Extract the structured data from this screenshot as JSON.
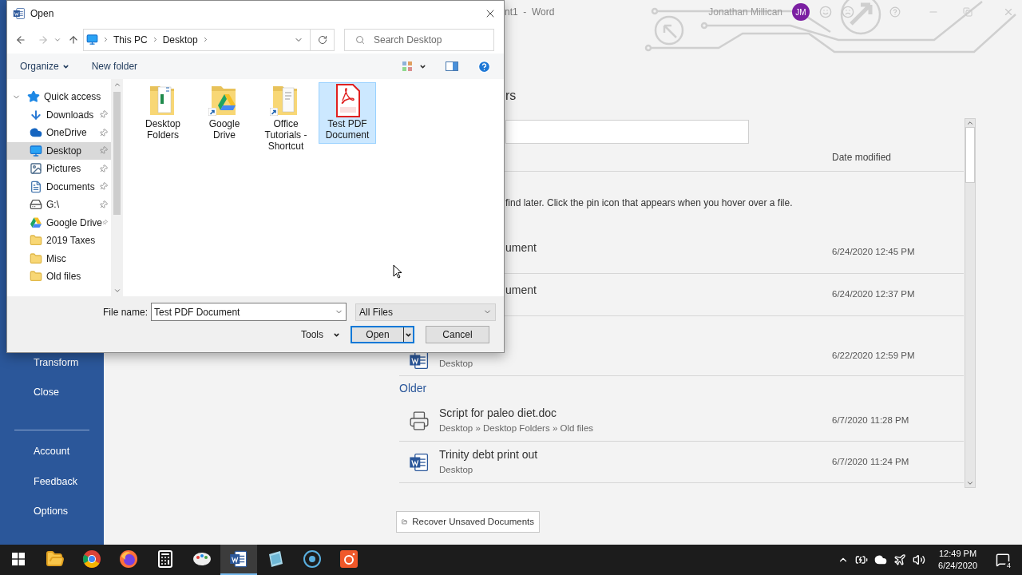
{
  "word": {
    "title": "nt1  -  Word",
    "user": "Jonathan Millican",
    "avatar": "JM",
    "sidebar_top": [
      "Transform",
      "Close"
    ],
    "sidebar_bottom": [
      "Account",
      "Feedback",
      "Options"
    ],
    "heading": "rs",
    "hint": "find later. Click the pin icon that appears when you hover over a file.",
    "date_header": "Date modified",
    "rows": [
      {
        "kind": "file",
        "name": "ument",
        "date": "6/24/2020 12:45 PM"
      },
      {
        "kind": "file",
        "name": "ument",
        "date": "6/24/2020 12:37 PM"
      },
      {
        "kind": "word",
        "location": "Desktop",
        "date": "6/22/2020 12:59 PM"
      },
      {
        "kind": "group",
        "label": "Older"
      },
      {
        "kind": "doc",
        "name": "Script for paleo diet.doc",
        "location": "Desktop » Desktop Folders » Old files",
        "date": "6/7/2020 11:28 PM"
      },
      {
        "kind": "word",
        "name": "Trinity debt print out",
        "location": "Desktop",
        "date": "6/7/2020 11:24 PM"
      }
    ],
    "recover_button": "Recover Unsaved Documents"
  },
  "dialog": {
    "title": "Open",
    "path": [
      "This PC",
      "Desktop"
    ],
    "search_placeholder": "Search Desktop",
    "organize": "Organize",
    "new_folder": "New folder",
    "nav": [
      {
        "label": "Quick access",
        "kind": "quickaccess",
        "expanded": true,
        "selected": false,
        "children": [
          {
            "label": "Downloads",
            "kind": "download",
            "pinned": true,
            "selected": false
          },
          {
            "label": "OneDrive",
            "kind": "cloud",
            "pinned": true,
            "selected": false
          },
          {
            "label": "Desktop",
            "kind": "desktop",
            "pinned": true,
            "selected": true
          },
          {
            "label": "Pictures",
            "kind": "pictures",
            "pinned": true,
            "selected": false
          },
          {
            "label": "Documents",
            "kind": "documents",
            "pinned": true,
            "selected": false
          },
          {
            "label": "G:\\",
            "kind": "drive",
            "pinned": true,
            "selected": false
          },
          {
            "label": "Google Drive",
            "kind": "gdrive",
            "pinned": true,
            "selected": false
          },
          {
            "label": "2019 Taxes",
            "kind": "folder",
            "pinned": false,
            "selected": false
          },
          {
            "label": "Misc",
            "kind": "folder",
            "pinned": false,
            "selected": false
          },
          {
            "label": "Old files",
            "kind": "folder",
            "pinned": false,
            "selected": false
          }
        ]
      }
    ],
    "items": [
      {
        "name": "Desktop Folders",
        "kind": "sheetfolder",
        "shortcut": false,
        "selected": false
      },
      {
        "name": "Google Drive",
        "kind": "drivefolder",
        "shortcut": true,
        "selected": false
      },
      {
        "name": "Office Tutorials - Shortcut",
        "kind": "docfolder",
        "shortcut": true,
        "selected": false
      },
      {
        "name": "Test PDF Document",
        "kind": "pdf",
        "shortcut": false,
        "selected": true
      }
    ],
    "file_name_label": "File name:",
    "file_name": "Test PDF Document",
    "file_type": "All Files",
    "tools": "Tools",
    "open": "Open",
    "cancel": "Cancel"
  },
  "taskbar": {
    "apps": [
      {
        "kind": "start",
        "active": false
      },
      {
        "kind": "explorer",
        "active": false
      },
      {
        "kind": "chrome",
        "active": false
      },
      {
        "kind": "firefox",
        "active": false
      },
      {
        "kind": "calculator",
        "active": false
      },
      {
        "kind": "paint",
        "active": false
      },
      {
        "kind": "word",
        "active": true
      },
      {
        "kind": "notes",
        "active": false
      },
      {
        "kind": "circle",
        "active": false
      },
      {
        "kind": "camera",
        "active": false
      }
    ],
    "time": "12:49 PM",
    "date": "6/24/2020",
    "notifications": "4"
  }
}
